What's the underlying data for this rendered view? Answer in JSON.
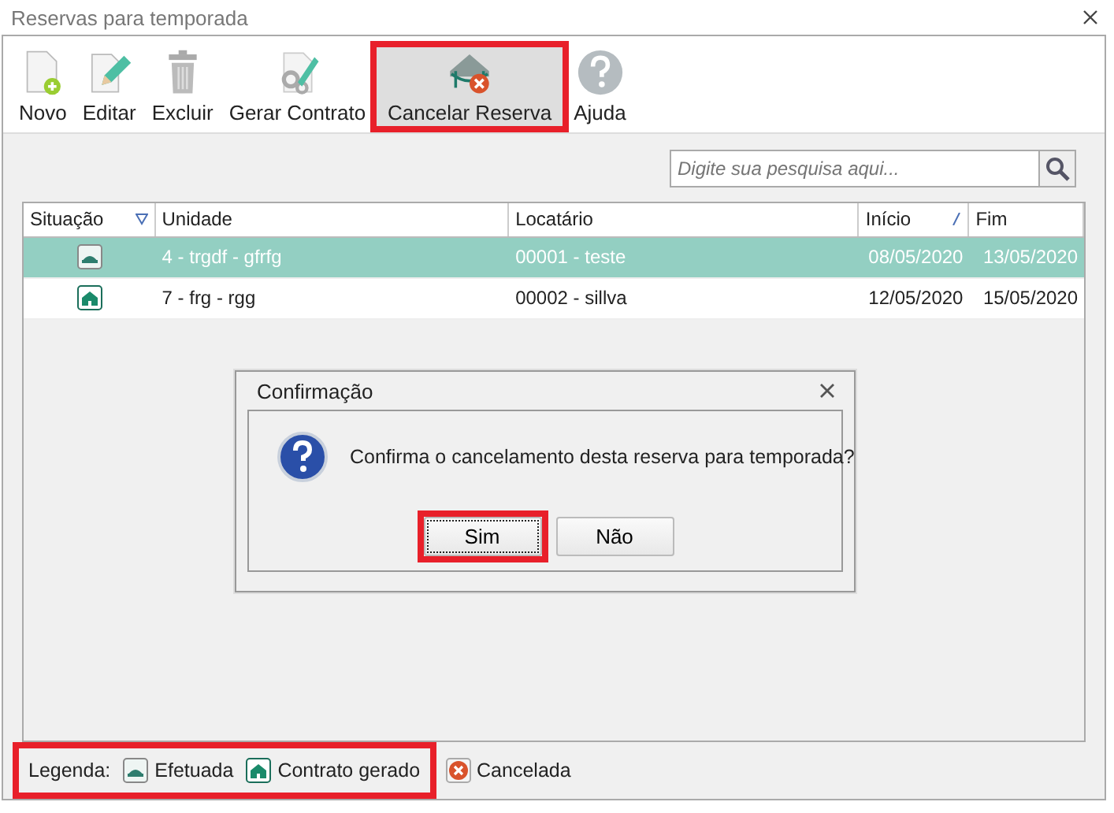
{
  "window": {
    "title": "Reservas para temporada"
  },
  "toolbar": [
    {
      "kind": "new",
      "label": "Novo",
      "highlighted": false
    },
    {
      "kind": "edit",
      "label": "Editar",
      "highlighted": false
    },
    {
      "kind": "delete",
      "label": "Excluir",
      "highlighted": false
    },
    {
      "kind": "contract",
      "label": "Gerar Contrato",
      "highlighted": false
    },
    {
      "kind": "cancel",
      "label": "Cancelar Reserva",
      "highlighted": true
    },
    {
      "kind": "help",
      "label": "Ajuda",
      "highlighted": false
    }
  ],
  "search": {
    "placeholder": "Digite sua pesquisa aqui..."
  },
  "table": {
    "columns": [
      {
        "label": "Situação",
        "kind": "filter"
      },
      {
        "label": "Unidade"
      },
      {
        "label": "Locatário"
      },
      {
        "label": "Início",
        "kind": "sort"
      },
      {
        "label": "Fim"
      }
    ],
    "rows": [
      {
        "kind": "efetuada",
        "unidade": "4 - trgdf - gfrfg",
        "locatario": "00001 - teste",
        "inicio": "08/05/2020",
        "fim": "13/05/2020",
        "selected": true
      },
      {
        "kind": "contrato",
        "unidade": "7 - frg - rgg",
        "locatario": "00002 - sillva",
        "inicio": "12/05/2020",
        "fim": "15/05/2020",
        "selected": false
      }
    ]
  },
  "dialog": {
    "title": "Confirmação",
    "message": "Confirma o cancelamento desta reserva para temporada?",
    "buttons": [
      {
        "label": "Sim",
        "highlighted": true,
        "focused": true
      },
      {
        "label": "Não",
        "highlighted": false,
        "focused": false
      }
    ]
  },
  "legend": {
    "groups": [
      {
        "highlighted": true,
        "label": "Legenda:",
        "items": [
          {
            "kind": "efetuada",
            "label": "Efetuada"
          },
          {
            "kind": "contrato",
            "label": "Contrato gerado"
          }
        ]
      },
      {
        "highlighted": false,
        "items": [
          {
            "kind": "cancelada",
            "label": "Cancelada"
          }
        ]
      }
    ]
  }
}
